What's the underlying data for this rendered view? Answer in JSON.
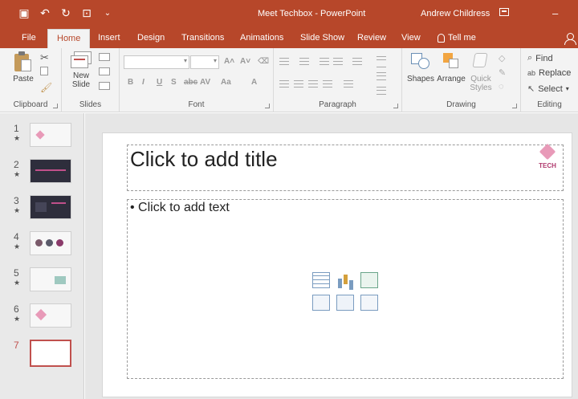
{
  "titlebar": {
    "document_title": "Meet Techbox  -  PowerPoint",
    "user_name": "Andrew Childress",
    "minimize_glyph": "–"
  },
  "tabs": [
    {
      "label": "File",
      "active": false
    },
    {
      "label": "Home",
      "active": true
    },
    {
      "label": "Insert",
      "active": false
    },
    {
      "label": "Design",
      "active": false
    },
    {
      "label": "Transitions",
      "active": false
    },
    {
      "label": "Animations",
      "active": false
    },
    {
      "label": "Slide Show",
      "active": false
    },
    {
      "label": "Review",
      "active": false
    },
    {
      "label": "View",
      "active": false
    }
  ],
  "tell_me": "Tell me",
  "ribbon": {
    "clipboard": {
      "label": "Clipboard",
      "paste": "Paste"
    },
    "slides": {
      "label": "Slides",
      "new_slide_line1": "New",
      "new_slide_line2": "Slide"
    },
    "font": {
      "label": "Font"
    },
    "paragraph": {
      "label": "Paragraph"
    },
    "drawing": {
      "label": "Drawing",
      "shapes": "Shapes",
      "arrange": "Arrange",
      "quick_line1": "Quick",
      "quick_line2": "Styles"
    },
    "editing": {
      "label": "Editing",
      "find": "Find",
      "replace": "Replace",
      "select": "Select"
    }
  },
  "thumbnails": [
    {
      "number": "1",
      "star": "★",
      "style": "light"
    },
    {
      "number": "2",
      "star": "★",
      "style": "dark"
    },
    {
      "number": "3",
      "star": "★",
      "style": "dark"
    },
    {
      "number": "4",
      "star": "★",
      "style": "light"
    },
    {
      "number": "5",
      "star": "★",
      "style": "light"
    },
    {
      "number": "6",
      "star": "★",
      "style": "light"
    },
    {
      "number": "7",
      "star": "",
      "style": "active"
    }
  ],
  "slide": {
    "title_placeholder": "Click to add title",
    "body_placeholder": "• Click to add text",
    "logo_text": "TECH"
  },
  "colors": {
    "accent": "#b7472a",
    "ribbon_bg": "#f3f3f3"
  }
}
